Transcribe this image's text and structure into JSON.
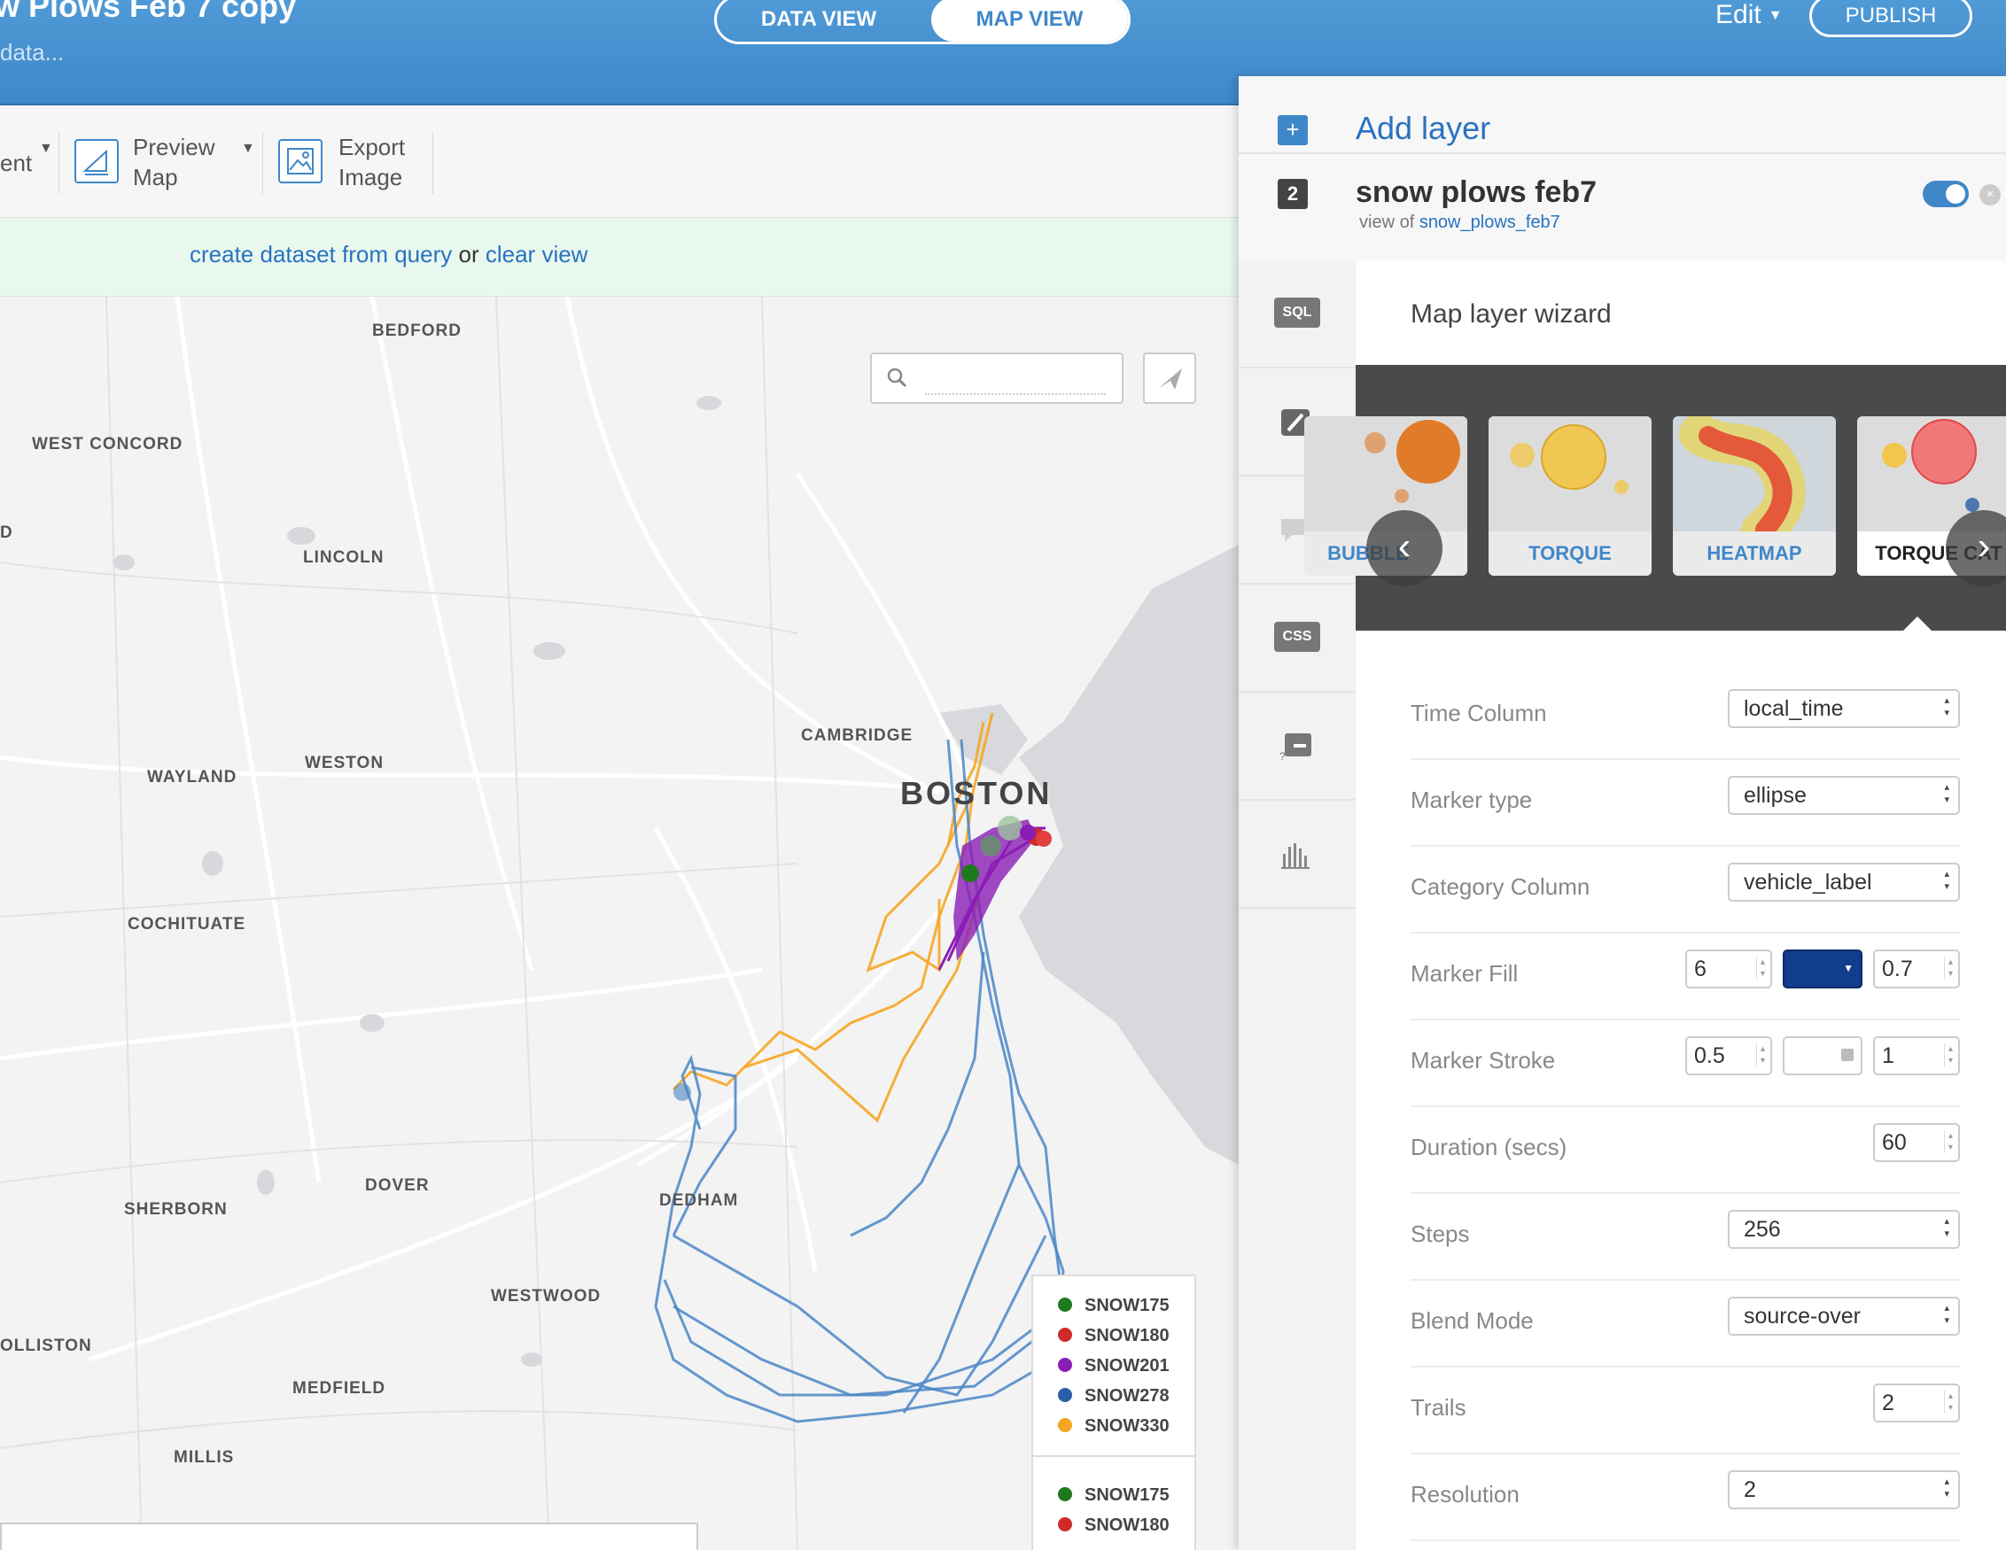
{
  "header": {
    "title": "w Plows Feb 7 copy",
    "subtitle": "data...",
    "tabs": [
      "DATA VIEW",
      "MAP VIEW"
    ],
    "active_tab": "MAP VIEW",
    "edit_label": "Edit",
    "publish_label": "PUBLISH"
  },
  "toolbar": {
    "partial_label": "ent",
    "preview": {
      "line1": "Preview",
      "line2": "Map"
    },
    "export": {
      "line1": "Export",
      "line2": "Image"
    }
  },
  "infobar": {
    "create_link": "create dataset from query",
    "or_text": "or",
    "clear_link": "clear view"
  },
  "map": {
    "places": [
      "BEDFORD",
      "WEST CONCORD",
      "LINCOLN",
      "CAMBRIDGE",
      "WAYLAND",
      "WESTON",
      "COCHITUATE",
      "DOVER",
      "SHERBORN",
      "DEDHAM",
      "WESTWOOD",
      "OLLISTON",
      "MEDFIELD",
      "MILLIS",
      "D"
    ],
    "city": "BOSTON",
    "search_placeholder": "",
    "legend": [
      {
        "label": "SNOW175",
        "color": "#1e7a1e"
      },
      {
        "label": "SNOW180",
        "color": "#d12a2a"
      },
      {
        "label": "SNOW201",
        "color": "#8a1db5"
      },
      {
        "label": "SNOW278",
        "color": "#2b5ea8"
      },
      {
        "label": "SNOW330",
        "color": "#f5a623"
      }
    ],
    "legend2": [
      {
        "label": "SNOW175",
        "color": "#1e7a1e"
      },
      {
        "label": "SNOW180",
        "color": "#d12a2a"
      }
    ]
  },
  "panel": {
    "add_layer": "Add layer",
    "layer_number": "2",
    "layer_name": "snow plows feb7",
    "view_of": "view of",
    "source_table": "snow_plows_feb7",
    "tools": [
      "SQL",
      "wizard",
      "infowindow",
      "CSS",
      "legend",
      "filters"
    ],
    "wizard_title": "Map layer wizard",
    "viz_types": [
      "BUBBLE",
      "TORQUE",
      "HEATMAP",
      "TORQUE CAT"
    ],
    "selected_viz": "TORQUE CAT",
    "form": {
      "time_column": {
        "label": "Time Column",
        "value": "local_time"
      },
      "marker_type": {
        "label": "Marker type",
        "value": "ellipse"
      },
      "category_column": {
        "label": "Category Column",
        "value": "vehicle_label"
      },
      "marker_fill": {
        "label": "Marker Fill",
        "size": "6",
        "color": "#123d8a",
        "opacity": "0.7"
      },
      "marker_stroke": {
        "label": "Marker Stroke",
        "width": "0.5",
        "opacity": "1"
      },
      "duration": {
        "label": "Duration (secs)",
        "value": "60"
      },
      "steps": {
        "label": "Steps",
        "value": "256"
      },
      "blend_mode": {
        "label": "Blend Mode",
        "value": "source-over"
      },
      "trails": {
        "label": "Trails",
        "value": "2"
      },
      "resolution": {
        "label": "Resolution",
        "value": "2"
      }
    }
  }
}
